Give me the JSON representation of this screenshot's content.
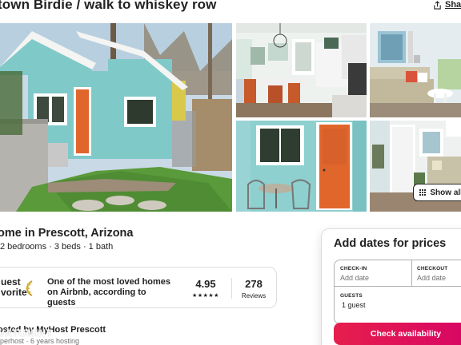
{
  "listing": {
    "title": "town Birdie / walk to whiskey row",
    "share_label": "Shar",
    "show_all_label": "Show all p",
    "subtitle": "ome in Prescott, Arizona",
    "details": "2 bedrooms · 3 beds · 1 bath"
  },
  "guest_favorite": {
    "badge_line1": "uest",
    "badge_line2": "vorite",
    "text": "One of the most loved homes on Airbnb, according to guests",
    "rating": "4.95",
    "stars": "★★★★★",
    "reviews_count": "278",
    "reviews_label": "Reviews"
  },
  "host": {
    "line": "osted by MyHost Prescott",
    "sub": "perhost · 6 years hosting"
  },
  "booking": {
    "title": "Add dates for prices",
    "checkin_label": "CHECK-IN",
    "checkin_value": "Add date",
    "checkout_label": "CHECKOUT",
    "checkout_value": "Add date",
    "guests_label": "GUESTS",
    "guests_value": "1 guest",
    "cta": "Check availability"
  },
  "watermark": "VATUMINT",
  "colors": {
    "cta_start": "#e61e4d",
    "cta_end": "#d70466",
    "house_teal": "#7fc9c9",
    "door_orange": "#e0662c"
  },
  "icons": {
    "share": "share-icon",
    "grid": "grid-icon",
    "laurel": "laurel-icon"
  }
}
